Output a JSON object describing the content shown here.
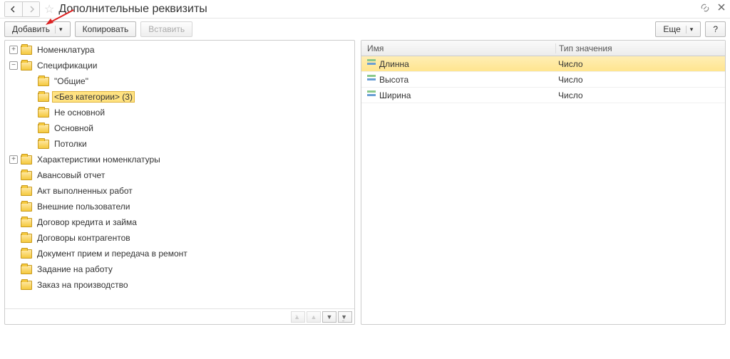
{
  "title": "Дополнительные реквизиты",
  "toolbar": {
    "add": "Добавить",
    "copy": "Копировать",
    "paste": "Вставить",
    "more": "Еще",
    "help": "?"
  },
  "tree": [
    {
      "indent": 0,
      "expander": "plus",
      "label": "Номенклатура"
    },
    {
      "indent": 0,
      "expander": "minus",
      "label": "Спецификации"
    },
    {
      "indent": 1,
      "expander": "none",
      "label": "\"Общие\""
    },
    {
      "indent": 1,
      "expander": "none",
      "label": "<Без категории> (3)",
      "selected": true
    },
    {
      "indent": 1,
      "expander": "none",
      "label": "Не основной"
    },
    {
      "indent": 1,
      "expander": "none",
      "label": "Основной"
    },
    {
      "indent": 1,
      "expander": "none",
      "label": "Потолки"
    },
    {
      "indent": 0,
      "expander": "plus",
      "label": "Характеристики номенклатуры"
    },
    {
      "indent": 0,
      "expander": "none",
      "label": "Авансовый отчет"
    },
    {
      "indent": 0,
      "expander": "none",
      "label": "Акт выполненных работ"
    },
    {
      "indent": 0,
      "expander": "none",
      "label": "Внешние пользователи"
    },
    {
      "indent": 0,
      "expander": "none",
      "label": "Договор кредита и займа"
    },
    {
      "indent": 0,
      "expander": "none",
      "label": "Договоры контрагентов"
    },
    {
      "indent": 0,
      "expander": "none",
      "label": "Документ прием и передача в ремонт"
    },
    {
      "indent": 0,
      "expander": "none",
      "label": "Задание на работу"
    },
    {
      "indent": 0,
      "expander": "none",
      "label": "Заказ на производство"
    }
  ],
  "grid": {
    "head_name": "Имя",
    "head_type": "Тип значения",
    "rows": [
      {
        "name": "Длинна",
        "type": "Число",
        "selected": true
      },
      {
        "name": "Высота",
        "type": "Число"
      },
      {
        "name": "Ширина",
        "type": "Число"
      }
    ]
  }
}
